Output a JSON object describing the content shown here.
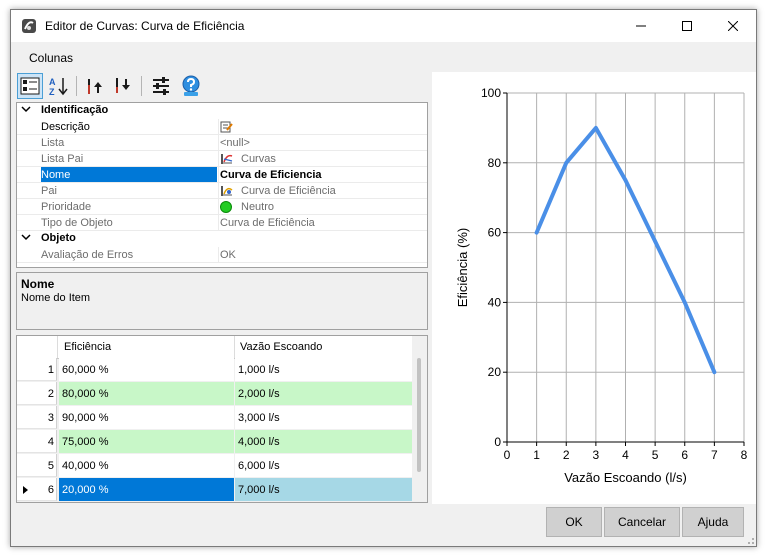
{
  "window": {
    "title": "Editor de Curvas: Curva de Eficiência"
  },
  "menu": {
    "items": [
      "Colunas"
    ]
  },
  "toolbar": {
    "buttons": [
      "categorized-view-icon",
      "sort-alpha-icon",
      "move-up-icon",
      "move-down-icon",
      "settings-sliders-icon",
      "help-globe-icon"
    ]
  },
  "property_grid": {
    "categories": [
      {
        "label": "Identificação",
        "rows": [
          {
            "name": "Descrição",
            "value": "",
            "icon": "edit-note-icon",
            "state": "normal"
          },
          {
            "name": "Lista",
            "value": "<null>",
            "icon": "",
            "state": "dim"
          },
          {
            "name": "Lista Pai",
            "value": "Curvas",
            "icon": "curves-list-icon",
            "state": "dim"
          },
          {
            "name": "Nome",
            "value": "Curva de Eficiencia",
            "icon": "",
            "state": "selected"
          },
          {
            "name": "Pai",
            "value": "Curva de Eficiência",
            "icon": "efficiency-curve-icon",
            "state": "dim"
          },
          {
            "name": "Prioridade",
            "value": "Neutro",
            "icon": "green-dot-icon",
            "state": "dim"
          },
          {
            "name": "Tipo de Objeto",
            "value": "Curva de Eficiência",
            "icon": "",
            "state": "dim"
          }
        ]
      },
      {
        "label": "Objeto",
        "rows": [
          {
            "name": "Avaliação de Erros",
            "value": "OK",
            "icon": "",
            "state": "dim"
          }
        ]
      }
    ]
  },
  "description": {
    "title": "Nome",
    "text": "Nome do Item"
  },
  "table": {
    "columns": [
      "Eficiência",
      "Vazão Escoando"
    ],
    "rows": [
      {
        "index": "1",
        "eficiencia": "60,000 %",
        "vazao": "1,000 l/s"
      },
      {
        "index": "2",
        "eficiencia": "80,000 %",
        "vazao": "2,000 l/s"
      },
      {
        "index": "3",
        "eficiencia": "90,000 %",
        "vazao": "3,000 l/s"
      },
      {
        "index": "4",
        "eficiencia": "75,000 %",
        "vazao": "4,000 l/s"
      },
      {
        "index": "5",
        "eficiencia": "40,000 %",
        "vazao": "6,000 l/s"
      },
      {
        "index": "6",
        "eficiencia": "20,000 %",
        "vazao": "7,000 l/s"
      }
    ],
    "current_row_index": 5,
    "alt_row_color": "#c8f7c8",
    "selected_color": "#0078d7",
    "selected_secondary_color": "#a6d8e6"
  },
  "chart_data": {
    "type": "line",
    "xlabel": "Vazão Escoando (l/s)",
    "ylabel": "Eficiência (%)",
    "xlim": [
      0,
      8
    ],
    "ylim": [
      0,
      100
    ],
    "xticks": [
      0,
      1,
      2,
      3,
      4,
      5,
      6,
      7,
      8
    ],
    "yticks": [
      0,
      20,
      40,
      60,
      80,
      100
    ],
    "grid": true,
    "line_color": "#4a8fe7",
    "series": [
      {
        "x": [
          1,
          2,
          3,
          4,
          6,
          7
        ],
        "y": [
          60,
          80,
          90,
          75,
          40,
          20
        ]
      }
    ]
  },
  "buttons": {
    "ok": "OK",
    "cancel": "Cancelar",
    "help": "Ajuda"
  }
}
